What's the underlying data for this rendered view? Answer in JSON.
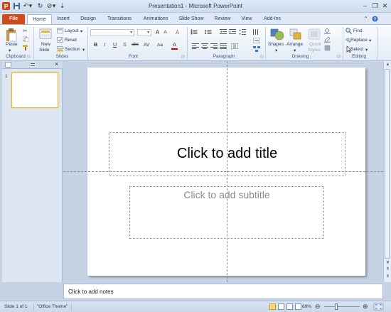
{
  "window": {
    "title": "Presentation1  -  Microsoft PowerPoint",
    "quick_access": [
      "save-icon",
      "undo-icon",
      "redo-icon",
      "customize-icon"
    ]
  },
  "tabs": [
    {
      "label": "File"
    },
    {
      "label": "Home"
    },
    {
      "label": "Insert"
    },
    {
      "label": "Design"
    },
    {
      "label": "Transitions"
    },
    {
      "label": "Animations"
    },
    {
      "label": "Slide Show"
    },
    {
      "label": "Review"
    },
    {
      "label": "View"
    },
    {
      "label": "Add-Ins"
    }
  ],
  "ribbon": {
    "clipboard": {
      "label": "Clipboard",
      "paste": "Paste"
    },
    "slides": {
      "label": "Slides",
      "new_slide_1": "New",
      "new_slide_2": "Slide",
      "layout": "Layout",
      "reset": "Reset",
      "section": "Section"
    },
    "font": {
      "label": "Font",
      "format_buttons": [
        "B",
        "I",
        "U",
        "S",
        "abc",
        "AV",
        "Aa",
        "A"
      ]
    },
    "paragraph": {
      "label": "Paragraph"
    },
    "drawing": {
      "label": "Drawing",
      "shapes": "Shapes",
      "arrange": "Arrange",
      "quick_styles_1": "Quick",
      "quick_styles_2": "Styles"
    },
    "editing": {
      "label": "Editing",
      "find": "Find",
      "replace": "Replace",
      "select": "Select"
    }
  },
  "slides_panel": {
    "thumbnail_number": "1"
  },
  "slide": {
    "title_placeholder": "Click to add title",
    "subtitle_placeholder": "Click to add subtitle"
  },
  "notes": {
    "placeholder": "Click to add notes"
  },
  "status": {
    "slide_info": "Slide 1 of 1",
    "theme": "\"Office Theme\"",
    "zoom": "69%"
  },
  "colors": {
    "file_tab": "#d04a1a",
    "chrome_blue": "#c5d3e5",
    "ribbon": "#fbfcfe",
    "slide_background": "#ffffff"
  }
}
